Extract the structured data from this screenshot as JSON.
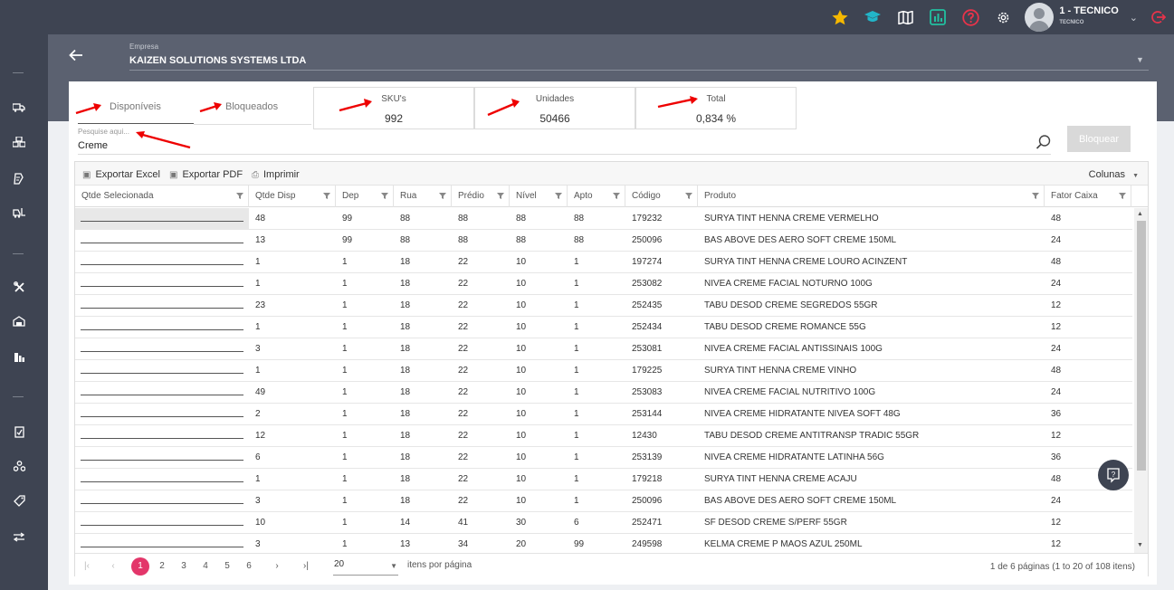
{
  "header": {
    "user_name": "1 - TECNICO",
    "user_role": "TECNICO"
  },
  "empresa": {
    "label": "Empresa",
    "name": "KAIZEN SOLUTIONS SYSTEMS LTDA"
  },
  "tabs": [
    {
      "label": "Disponíveis",
      "active": true
    },
    {
      "label": "Bloqueados",
      "active": false
    }
  ],
  "stats": [
    {
      "label": "SKU's",
      "value": "992"
    },
    {
      "label": "Unidades",
      "value": "50466"
    },
    {
      "label": "Total",
      "value": "0,834 %"
    }
  ],
  "search": {
    "label": "Pesquise aqui...",
    "value": "Creme"
  },
  "block_button": "Bloquear",
  "toolbar": {
    "excel": "Exportar Excel",
    "pdf": "Exportar PDF",
    "print": "Imprimir",
    "columns": "Colunas"
  },
  "columns": [
    "Qtde Selecionada",
    "Qtde Disp",
    "Dep",
    "Rua",
    "Prédio",
    "Nível",
    "Apto",
    "Código",
    "Produto",
    "Fator Caixa"
  ],
  "rows": [
    [
      "",
      "48",
      "99",
      "88",
      "88",
      "88",
      "88",
      "179232",
      "SURYA TINT HENNA CREME VERMELHO",
      "48"
    ],
    [
      "",
      "13",
      "99",
      "88",
      "88",
      "88",
      "88",
      "250096",
      "BAS ABOVE DES AERO SOFT CREME 150ML",
      "24"
    ],
    [
      "",
      "1",
      "1",
      "18",
      "22",
      "10",
      "1",
      "197274",
      "SURYA TINT HENNA CREME LOURO ACINZENT",
      "48"
    ],
    [
      "",
      "1",
      "1",
      "18",
      "22",
      "10",
      "1",
      "253082",
      "NIVEA CREME FACIAL NOTURNO 100G",
      "24"
    ],
    [
      "",
      "23",
      "1",
      "18",
      "22",
      "10",
      "1",
      "252435",
      "TABU DESOD CREME SEGREDOS 55GR",
      "12"
    ],
    [
      "",
      "1",
      "1",
      "18",
      "22",
      "10",
      "1",
      "252434",
      "TABU DESOD CREME ROMANCE 55G",
      "12"
    ],
    [
      "",
      "3",
      "1",
      "18",
      "22",
      "10",
      "1",
      "253081",
      "NIVEA CREME FACIAL ANTISSINAIS 100G",
      "24"
    ],
    [
      "",
      "1",
      "1",
      "18",
      "22",
      "10",
      "1",
      "179225",
      "SURYA TINT HENNA CREME VINHO",
      "48"
    ],
    [
      "",
      "49",
      "1",
      "18",
      "22",
      "10",
      "1",
      "253083",
      "NIVEA CREME FACIAL NUTRITIVO 100G",
      "24"
    ],
    [
      "",
      "2",
      "1",
      "18",
      "22",
      "10",
      "1",
      "253144",
      "NIVEA CREME HIDRATANTE NIVEA SOFT 48G",
      "36"
    ],
    [
      "",
      "12",
      "1",
      "18",
      "22",
      "10",
      "1",
      "12430",
      "TABU DESOD CREME ANTITRANSP TRADIC 55GR",
      "12"
    ],
    [
      "",
      "6",
      "1",
      "18",
      "22",
      "10",
      "1",
      "253139",
      "NIVEA CREME HIDRATANTE LATINHA 56G",
      "36"
    ],
    [
      "",
      "1",
      "1",
      "18",
      "22",
      "10",
      "1",
      "179218",
      "SURYA TINT HENNA CREME ACAJU",
      "48"
    ],
    [
      "",
      "3",
      "1",
      "18",
      "22",
      "10",
      "1",
      "250096",
      "BAS ABOVE DES AERO SOFT CREME 150ML",
      "24"
    ],
    [
      "",
      "10",
      "1",
      "14",
      "41",
      "30",
      "6",
      "252471",
      "SF DESOD CREME S/PERF 55GR",
      "12"
    ],
    [
      "",
      "3",
      "1",
      "13",
      "34",
      "20",
      "99",
      "249598",
      "KELMA CREME P MAOS AZUL 250ML",
      "12"
    ]
  ],
  "pager": {
    "pages": [
      "1",
      "2",
      "3",
      "4",
      "5",
      "6"
    ],
    "current": "1",
    "page_size": "20",
    "items_per_page": "itens por página",
    "info": "1 de 6 páginas (1 to 20 of 108 itens)"
  },
  "colors": {
    "sidebar": "#3e4452",
    "band": "#5b6170",
    "accent": "#e3366a",
    "star": "#f5b800",
    "teal": "#22b5c9",
    "help": "#e8334a"
  },
  "icons": [
    "star-icon",
    "graduation-cap-icon",
    "map-icon",
    "report-icon",
    "help-circle-icon",
    "gear-icon",
    "logout-icon",
    "search-icon",
    "excel-icon",
    "pdf-icon",
    "print-icon",
    "filter-icon",
    "chat-help-icon"
  ]
}
